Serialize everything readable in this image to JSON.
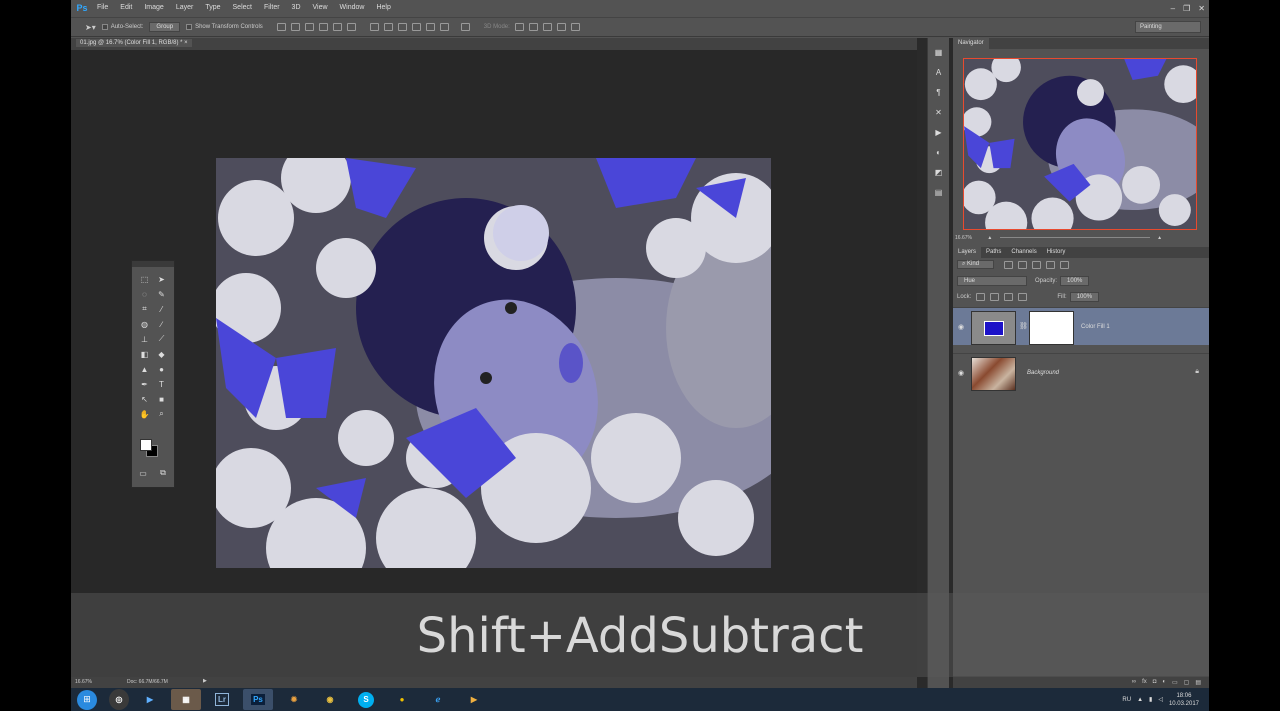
{
  "app": {
    "logo": "Ps",
    "menu": [
      "File",
      "Edit",
      "Image",
      "Layer",
      "Type",
      "Select",
      "Filter",
      "3D",
      "View",
      "Window",
      "Help"
    ],
    "window_controls": [
      "–",
      "❐",
      "✕"
    ]
  },
  "options": {
    "auto_select_label": "Auto-Select:",
    "auto_select_value": "Group",
    "transform_label": "Show Transform Controls",
    "mode_3d_label": "3D Mode:",
    "workspace": "Painting"
  },
  "document": {
    "tab_title": "01.jpg @ 16.7% (Color Fill 1, RGB/8) *",
    "zoom": "16.67%",
    "doc_info": "Doc: 66.7M/66.7M"
  },
  "navigator": {
    "tab": "Navigator",
    "zoom": "16.67%"
  },
  "layers_panel": {
    "tabs": [
      "Layers",
      "Paths",
      "Channels",
      "History"
    ],
    "kind_label": "Kind",
    "blend_mode": "Hue",
    "opacity_label": "Opacity:",
    "opacity_value": "100%",
    "lock_label": "Lock:",
    "fill_label": "Fill:",
    "fill_value": "100%",
    "layers": [
      {
        "name": "Color Fill 1",
        "selected": true,
        "fill_color": "#1c12c8"
      },
      {
        "name": "Background",
        "selected": false,
        "locked": true
      }
    ]
  },
  "caption": "Shift+AddSubtract",
  "taskbar": {
    "apps": [
      "start",
      "chrome-alt",
      "media",
      "explorer",
      "Lr",
      "Ps",
      "extra",
      "chrome",
      "S",
      "yellow",
      "ie",
      "folder"
    ],
    "lang": "RU",
    "time": "18:06",
    "date": "10.03.2017"
  },
  "colors": {
    "accent_blue": "#31a8ff",
    "fill_color": "#1c12c8",
    "selected_layer": "#6c7a97",
    "navigator_border": "#e84a2f"
  }
}
